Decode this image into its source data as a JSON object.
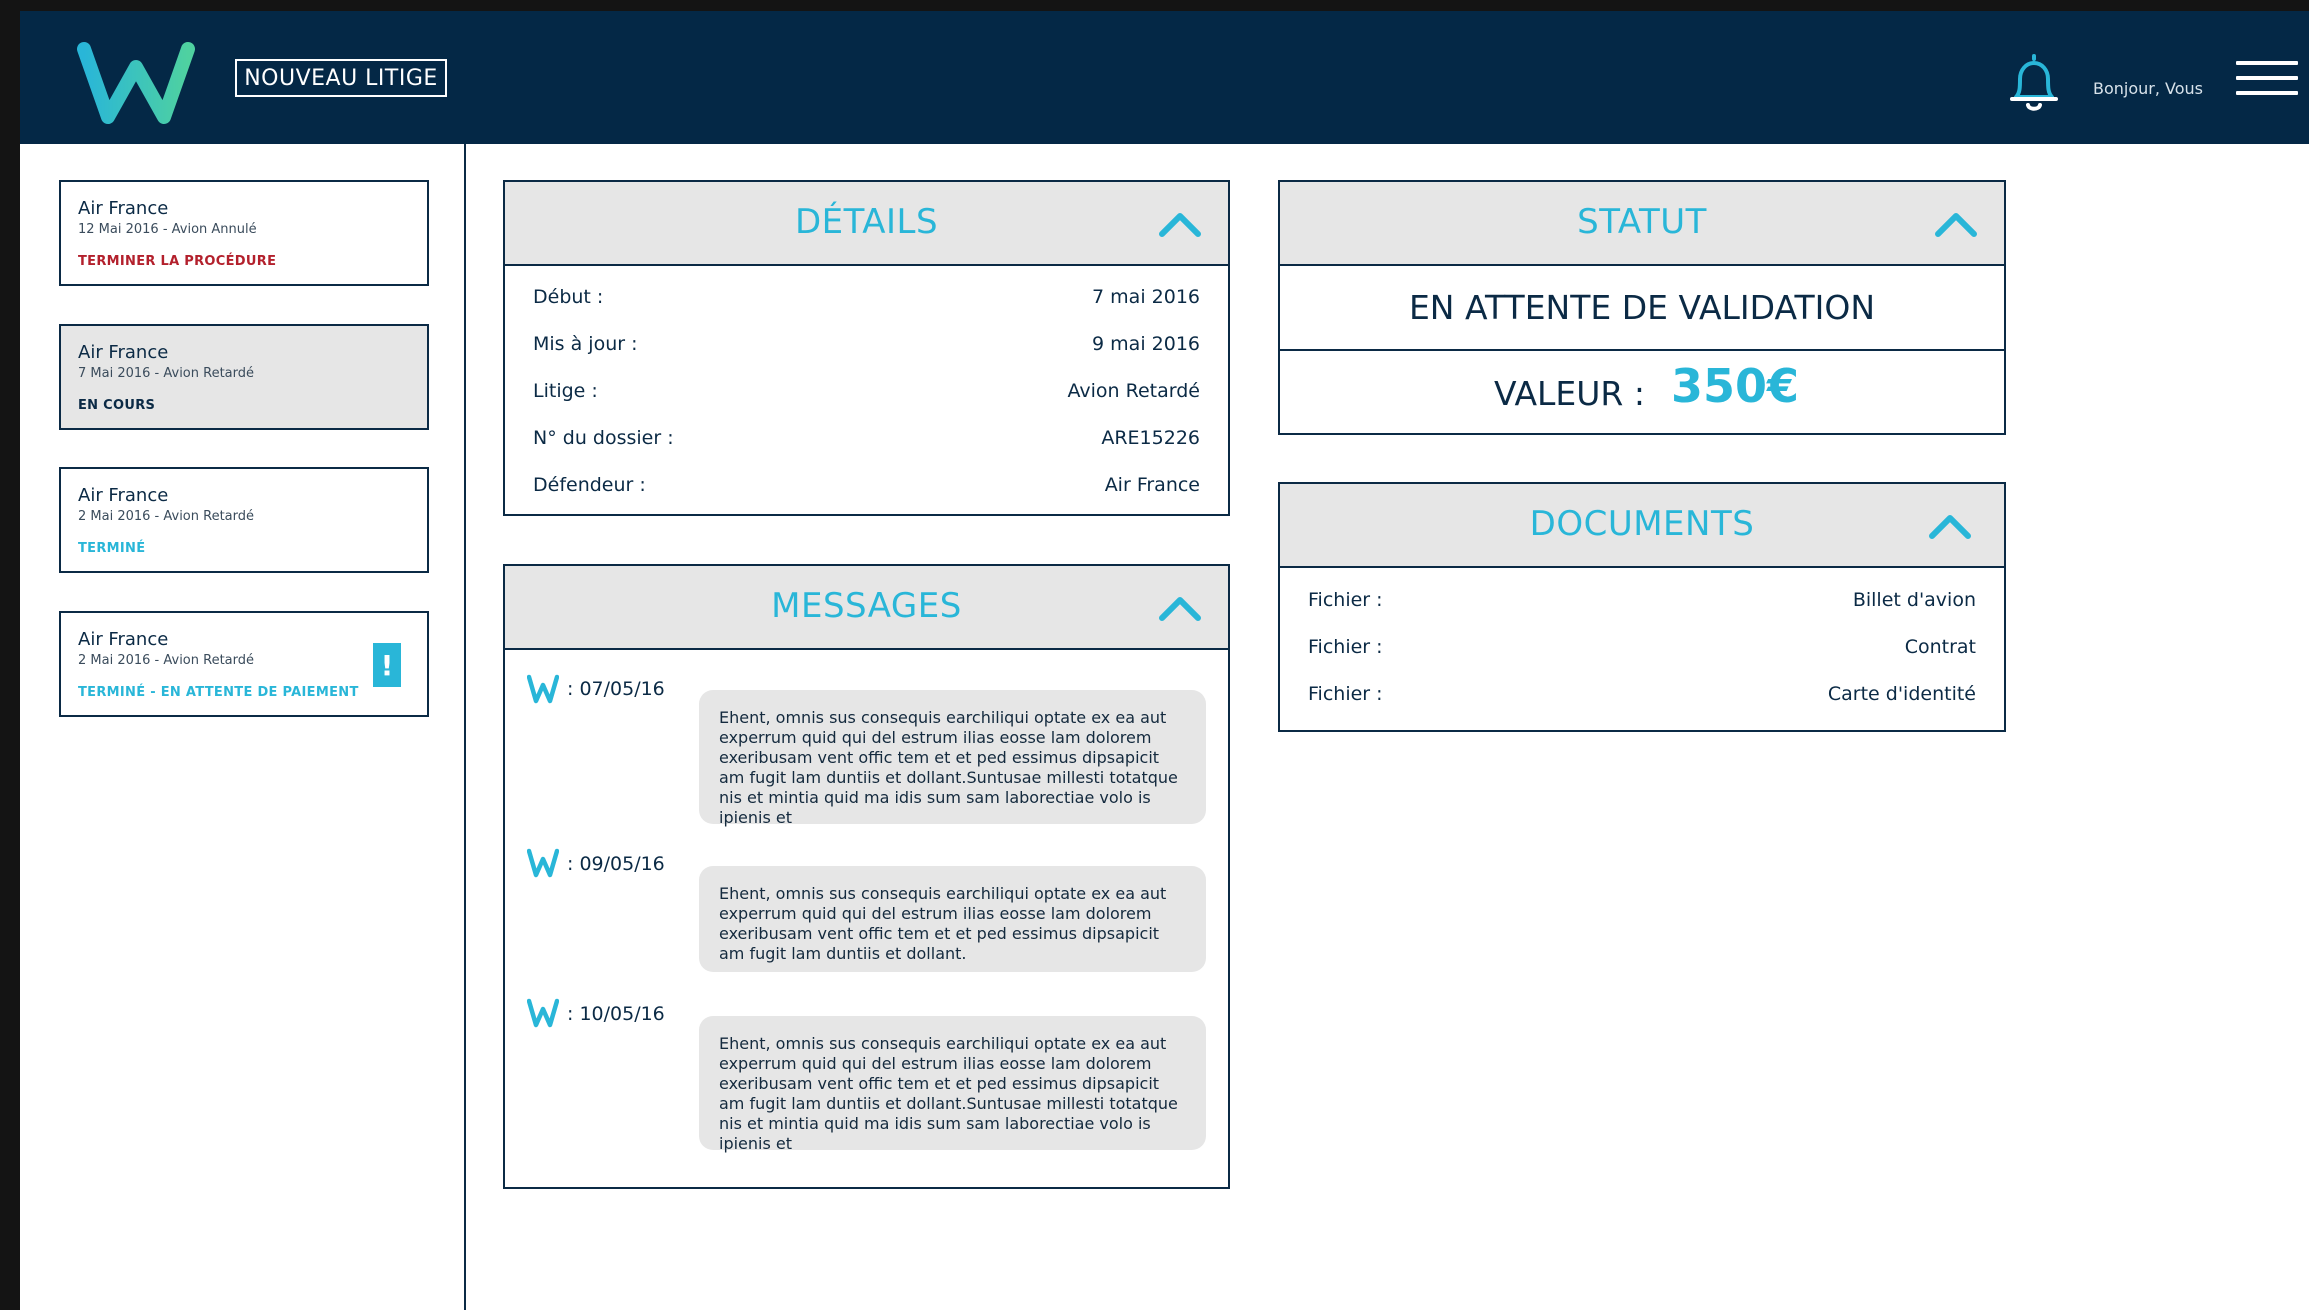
{
  "header": {
    "new_button": "NOUVEAU LITIGE",
    "greeting": "Bonjour, Vous",
    "logo_icon": "w-logo-icon",
    "bell_icon": "bell-icon",
    "menu_icon": "hamburger-menu-icon"
  },
  "cases": [
    {
      "company": "Air France",
      "subtitle": "12 Mai 2016 - Avion Annulé",
      "status": "TERMINER LA PROCÉDURE",
      "status_color": "#b3202c",
      "active": false,
      "alert": ""
    },
    {
      "company": "Air France",
      "subtitle": "7 Mai 2016 - Avion Retardé",
      "status": "EN COURS",
      "status_color": "#0b2a45",
      "active": true,
      "alert": ""
    },
    {
      "company": "Air France",
      "subtitle": "2 Mai 2016 - Avion Retardé",
      "status": "TERMINÉ",
      "status_color": "#29b6d8",
      "active": false,
      "alert": ""
    },
    {
      "company": "Air France",
      "subtitle": "2 Mai 2016 - Avion Retardé",
      "status": "TERMINÉ - EN ATTENTE DE PAIEMENT",
      "status_color": "#29b6d8",
      "active": false,
      "alert": "!"
    }
  ],
  "details": {
    "title": "DÉTAILS",
    "rows": [
      {
        "label": "Début :",
        "value": "7 mai 2016"
      },
      {
        "label": "Mis à jour :",
        "value": "9 mai 2016"
      },
      {
        "label": "Litige :",
        "value": "Avion Retardé"
      },
      {
        "label": "N° du dossier :",
        "value": "ARE15226"
      },
      {
        "label": "Défendeur :",
        "value": "Air France"
      }
    ]
  },
  "messages": {
    "title": "MESSAGES",
    "items": [
      {
        "date": ": 07/05/16",
        "text": "Ehent, omnis sus consequis earchiliqui optate ex ea aut experrum quid qui del estrum ilias eosse lam dolorem exeribusam vent offic tem et et ped essimus dipsapicit am fugit lam duntiis et dollant.Suntusae millesti totatque nis et mintia quid ma idis sum sam laborectiae volo is ipienis et"
      },
      {
        "date": ": 09/05/16",
        "text": "Ehent, omnis sus consequis earchiliqui optate ex ea aut experrum quid qui del estrum ilias eosse lam dolorem exeribusam vent offic tem et et ped essimus dipsapicit am fugit lam duntiis et dollant."
      },
      {
        "date": ": 10/05/16",
        "text": "Ehent, omnis sus consequis earchiliqui optate ex ea aut experrum quid qui del estrum ilias eosse lam dolorem exeribusam vent offic tem et et ped essimus dipsapicit am fugit lam duntiis et dollant.Suntusae millesti totatque nis et mintia quid ma idis sum sam laborectiae volo is ipienis et"
      }
    ]
  },
  "status": {
    "title": "STATUT",
    "state": "EN ATTENTE DE VALIDATION",
    "value_label": "VALEUR :",
    "value_amount": "350€"
  },
  "documents": {
    "title": "DOCUMENTS",
    "rows": [
      {
        "label": "Fichier :",
        "value": "Billet d'avion"
      },
      {
        "label": "Fichier :",
        "value": "Contrat"
      },
      {
        "label": "Fichier :",
        "value": "Carte d'identité"
      }
    ]
  },
  "colors": {
    "navy": "#042846",
    "accent": "#29b6d8",
    "panel_head": "#e6e6e6",
    "error": "#b3202c"
  }
}
